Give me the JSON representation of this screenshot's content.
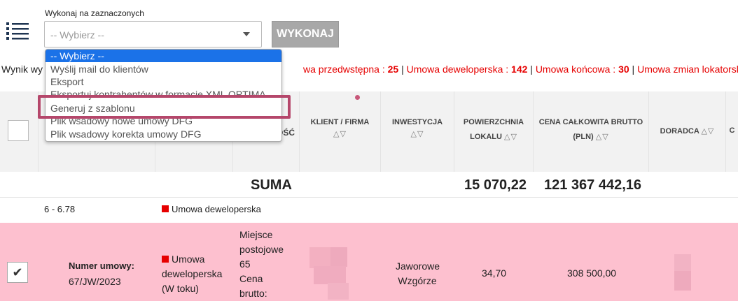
{
  "bulk_action": {
    "label": "Wykonaj na zaznaczonych",
    "selected": "-- Wybierz --",
    "execute_label": "WYKONAJ",
    "options": [
      "-- Wybierz --",
      "Wyślij mail do klientów",
      "Eksport",
      "Eksportuj kontrahentów w formacie XML OPTIMA",
      "Generuj z szablonu",
      "Plik wsadowy nowe umowy DFG",
      "Plik wsadowy korekta umowy DFG"
    ]
  },
  "results": {
    "prefix": "Wynik wy",
    "items": [
      {
        "label": "wa przedwstępna : ",
        "count": "25"
      },
      {
        "label": "Umowa deweloperska : ",
        "count": "142"
      },
      {
        "label": "Umowa końcowa : ",
        "count": "30"
      },
      {
        "label": "Umowa zmian lokatorskich",
        "count": ""
      }
    ],
    "separator": " | "
  },
  "table": {
    "headers": {
      "hidden_partial": "OŚĆ",
      "client": "KLIENT / FIRMA",
      "investment": "INWESTYCJA",
      "area_line1": "POWIERZCHNIA",
      "area_line2": "LOKALU",
      "price_line1": "CENA CAŁKOWITA BRUTTO",
      "price_line2": "(PLN)",
      "advisor": "DORADCA",
      "last_partial": "C"
    },
    "sort_glyph": "△▽",
    "suma": {
      "label": "SUMA",
      "area": "15 070,22",
      "price": "121 367 442,16"
    },
    "group_row": {
      "range": "6 - 6.78",
      "status": "Umowa deweloperska"
    },
    "row": {
      "contract_label": "Numer umowy:",
      "contract_number": "67/JW/2023",
      "status_line1": "Umowa",
      "status_line2": "deweloperska",
      "status_line3": "(W toku)",
      "detail_lines": [
        "Miejsce",
        "postojowe",
        "65",
        "Cena",
        "brutto:"
      ],
      "investment_line1": "Jaworowe",
      "investment_line2": "Wzgórze",
      "area": "34,70",
      "price": "308 500,00",
      "checked_glyph": "✔"
    }
  },
  "colors": {
    "accent_red": "#e60000",
    "row_pink": "#fdc0cf",
    "highlight": "#b5476b",
    "select_blue": "#1b72e8"
  }
}
